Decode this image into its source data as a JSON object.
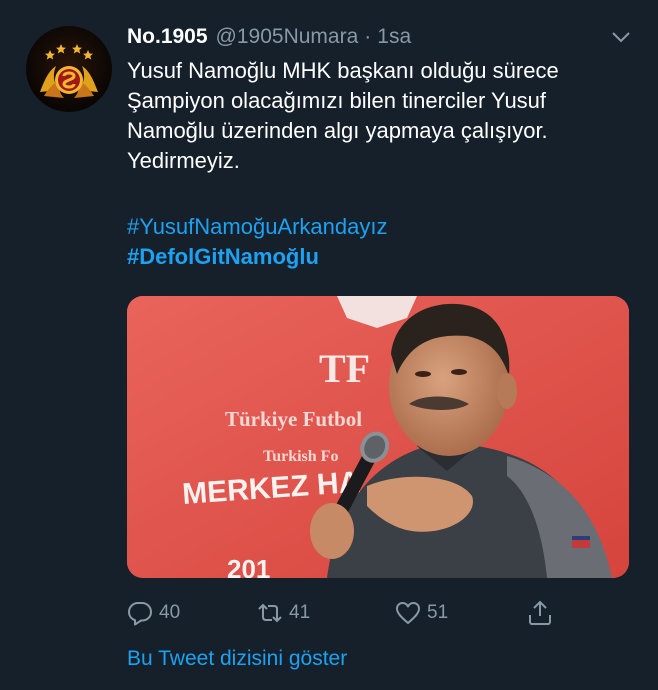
{
  "tweet": {
    "display_name": "No.1905",
    "handle": "@1905Numara",
    "separator": "·",
    "time": "1sa",
    "text_lines": [
      "Yusuf Namoğlu MHK başkanı olduğu sürece",
      "Şampiyon olacağımızı bilen tinerciler Yusuf",
      "Namoğlu üzerinden algı yapmaya çalışıyor.",
      "Yedirmeyiz."
    ],
    "hashtags": [
      "#YusufNamoğuArkandayız",
      "#DefolGitNamoğlu"
    ],
    "media": {
      "sign_text_1": "TF",
      "sign_text_2": "Türkiye Futbol",
      "sign_text_3": "Turkish Fo",
      "sign_text_4": "MERKEZ HA",
      "sign_text_5": "201"
    }
  },
  "actions": {
    "reply_count": "40",
    "retweet_count": "41",
    "like_count": "51"
  },
  "show_thread_label": "Bu Tweet dizisini göster",
  "colors": {
    "background": "#15202b",
    "secondary_text": "#8899a6",
    "link": "#1da1f2"
  },
  "icons": {
    "reply": "reply-icon",
    "retweet": "retweet-icon",
    "like": "heart-icon",
    "share": "share-icon",
    "more": "chevron-down-icon"
  }
}
